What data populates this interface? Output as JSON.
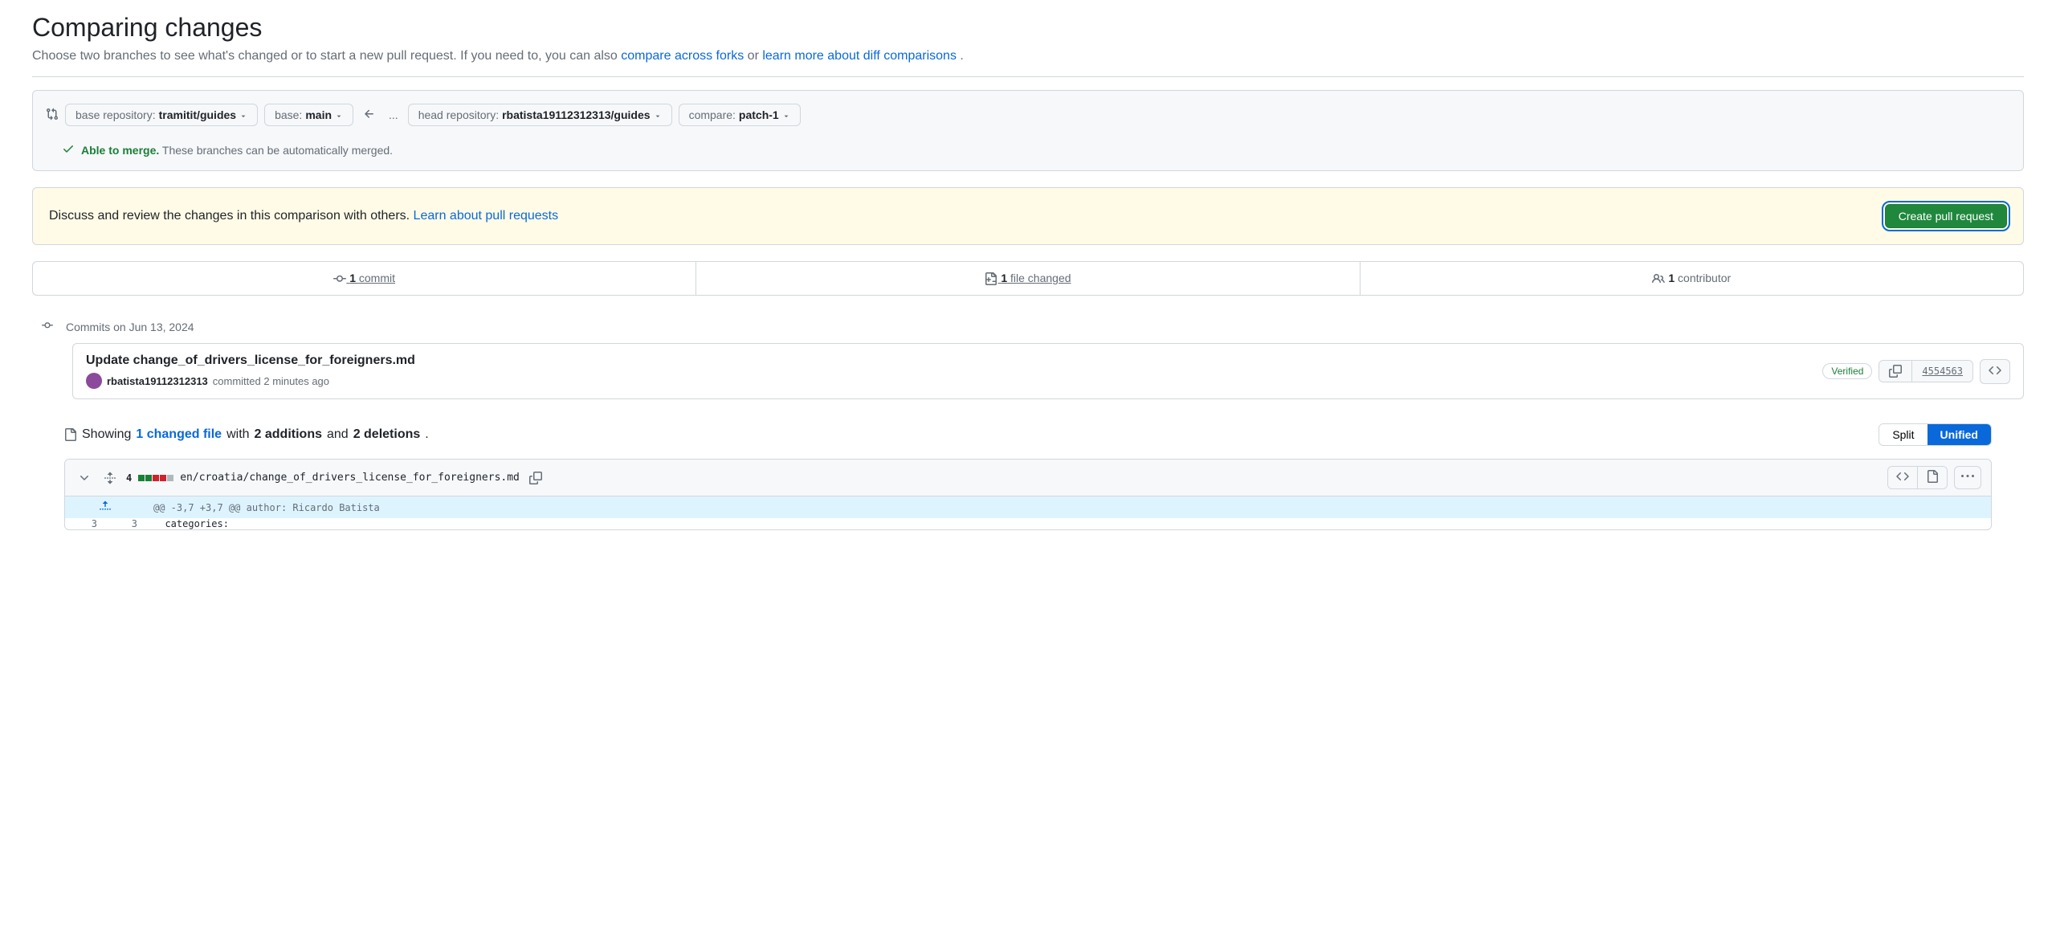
{
  "header": {
    "title": "Comparing changes",
    "subtitle_prefix": "Choose two branches to see what's changed or to start a new pull request. If you need to, you can also ",
    "compare_forks_link": "compare across forks",
    "subtitle_middle": " or ",
    "learn_more_link": "learn more about diff comparisons",
    "subtitle_suffix": "."
  },
  "compare": {
    "base_repo_label": "base repository: ",
    "base_repo_value": "tramitit/guides",
    "base_label": "base: ",
    "base_value": "main",
    "head_repo_label": "head repository: ",
    "head_repo_value": "rbatista19112312313/guides",
    "compare_label": "compare: ",
    "compare_value": "patch-1",
    "ellipsis": "...",
    "merge_able": "Able to merge.",
    "merge_text": " These branches can be automatically merged."
  },
  "discuss": {
    "text_prefix": "Discuss and review the changes in this comparison with others. ",
    "link_text": "Learn about pull requests",
    "button_label": "Create pull request"
  },
  "stats": {
    "commits_count": "1",
    "commits_label": " commit",
    "files_count": "1",
    "files_label": " file changed",
    "contributors_count": "1",
    "contributors_label": " contributor"
  },
  "commits": {
    "date_label": "Commits on Jun 13, 2024",
    "items": [
      {
        "title": "Update change_of_drivers_license_for_foreigners.md",
        "author": "rbatista19112312313",
        "meta_text": " committed 2 minutes ago",
        "verified": "Verified",
        "hash": "4554563"
      }
    ]
  },
  "file_summary": {
    "showing_prefix": "Showing ",
    "changed_file_link": "1 changed file",
    "with_text": " with ",
    "additions": "2 additions",
    "and_text": " and ",
    "deletions": "2 deletions",
    "period": "."
  },
  "view_toggle": {
    "split": "Split",
    "unified": "Unified"
  },
  "file_diff": {
    "change_count": "4",
    "file_path": "en/croatia/change_of_drivers_license_for_foreigners.md",
    "hunk_header": "@@ -3,7 +3,7 @@ author: Ricardo Batista",
    "line_3_old": "3",
    "line_3_new": "3",
    "line_3_code": "categories:"
  }
}
